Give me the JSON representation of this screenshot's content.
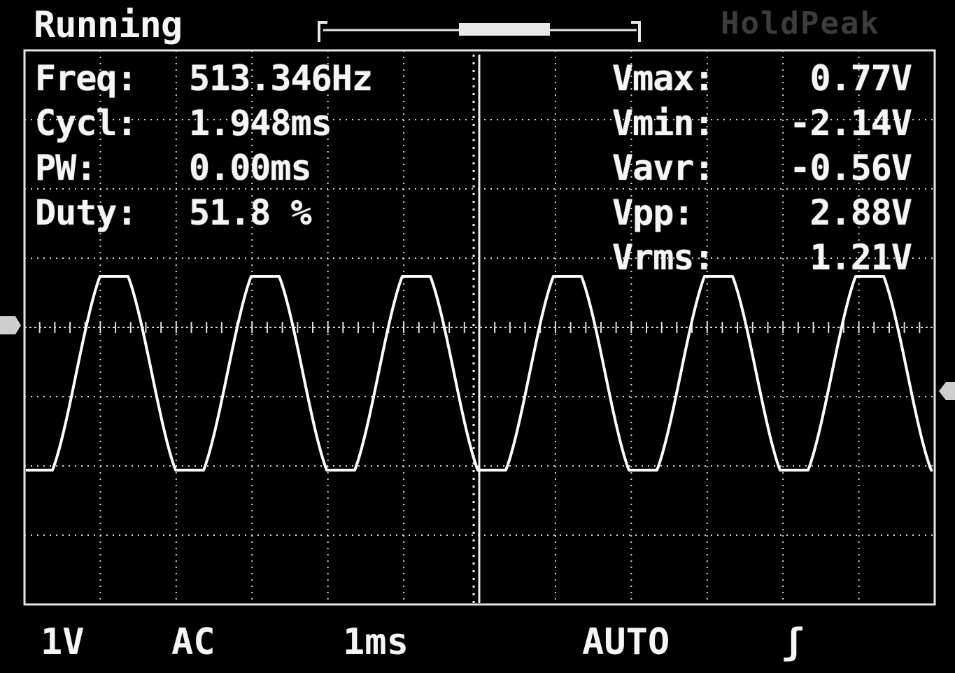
{
  "header": {
    "status": "Running",
    "brand": "HoldPeak"
  },
  "measurements_left": [
    {
      "label": "Freq:",
      "value": "513.346Hz"
    },
    {
      "label": "Cycl:",
      "value": "1.948ms"
    },
    {
      "label": "PW:",
      "value": "0.00ms"
    },
    {
      "label": "Duty:",
      "value": "51.8 %"
    }
  ],
  "measurements_right": [
    {
      "label": "Vmax:",
      "value": "0.77V"
    },
    {
      "label": "Vmin:",
      "value": "-2.14V"
    },
    {
      "label": "Vavr:",
      "value": "-0.56V"
    },
    {
      "label": "Vpp:",
      "value": "2.88V"
    },
    {
      "label": "Vrms:",
      "value": "1.21V"
    }
  ],
  "settings": {
    "volts_per_div": "1V",
    "coupling": "AC",
    "time_per_div": "1ms",
    "trigger_mode": "AUTO",
    "trigger_edge": "ʃ"
  },
  "colors": {
    "trace": "#ffffff",
    "grid": "#e6e6e6",
    "background": "#000000"
  }
}
